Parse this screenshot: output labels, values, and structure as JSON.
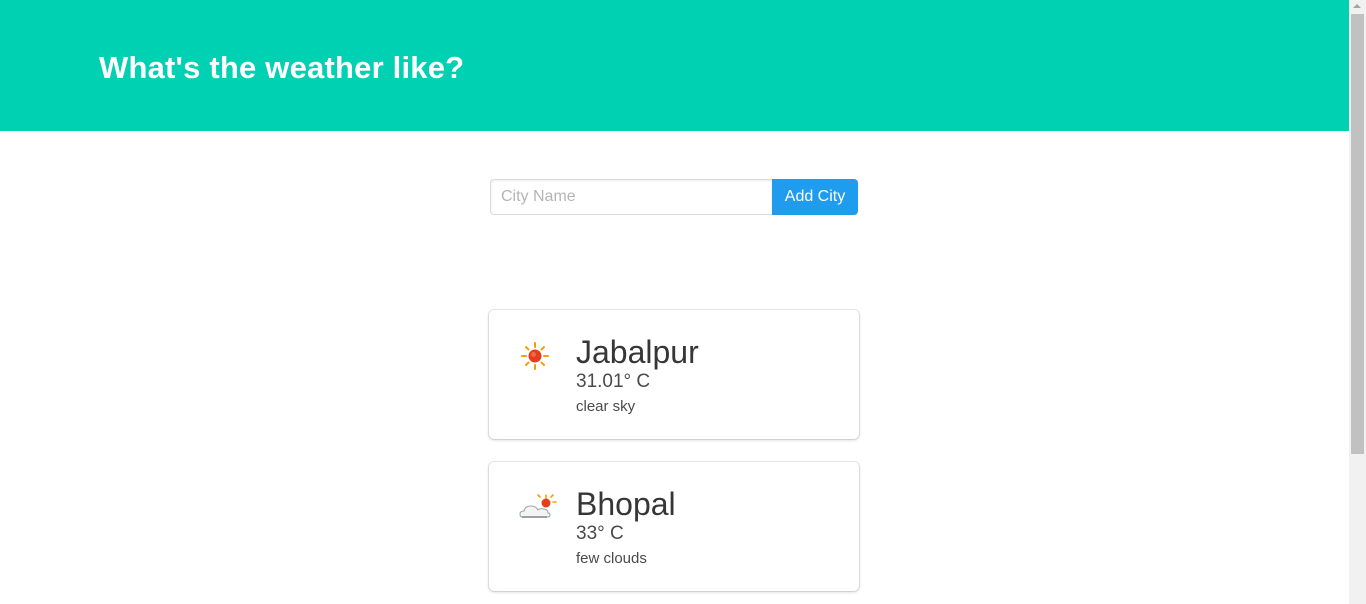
{
  "header": {
    "title": "What's the weather like?",
    "background_color": "#00d1b2"
  },
  "search": {
    "placeholder": "City Name",
    "value": "",
    "button_label": "Add City",
    "button_color": "#209cee"
  },
  "cities": [
    {
      "name": "Jabalpur",
      "temperature": "31.01° C",
      "description": "clear sky",
      "icon": "clear-sky-sun-icon"
    },
    {
      "name": "Bhopal",
      "temperature": "33° C",
      "description": "few clouds",
      "icon": "few-clouds-icon"
    }
  ]
}
